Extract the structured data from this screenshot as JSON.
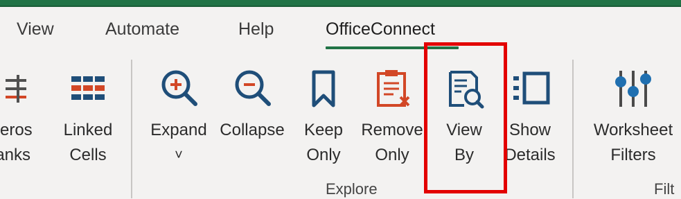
{
  "ribbon": {
    "tabs": [
      {
        "label": "View"
      },
      {
        "label": "Automate"
      },
      {
        "label": "Help"
      },
      {
        "label": "OfficeConnect",
        "active": true
      }
    ],
    "buttons": {
      "zeros_blanks": {
        "line1": "Zeros",
        "line2": "lanks"
      },
      "linked_cells": {
        "line1": "Linked",
        "line2": "Cells"
      },
      "expand": {
        "line1": "Expand",
        "line2": "˅"
      },
      "collapse": {
        "line1": "Collapse"
      },
      "keep_only": {
        "line1": "Keep",
        "line2": "Only"
      },
      "remove_only": {
        "line1": "Remove",
        "line2": "Only"
      },
      "view_by": {
        "line1": "View",
        "line2": "By"
      },
      "show_details": {
        "line1": "Show",
        "line2": "Details"
      },
      "worksheet_filters": {
        "line1": "Worksheet",
        "line2": "Filters"
      }
    },
    "groups": {
      "explore": "Explore",
      "filters": "Filt"
    }
  },
  "colors": {
    "title_bar": "#217346",
    "accent_blue": "#1f4e79",
    "accent_orange": "#d24726",
    "highlight": "#e30000"
  }
}
